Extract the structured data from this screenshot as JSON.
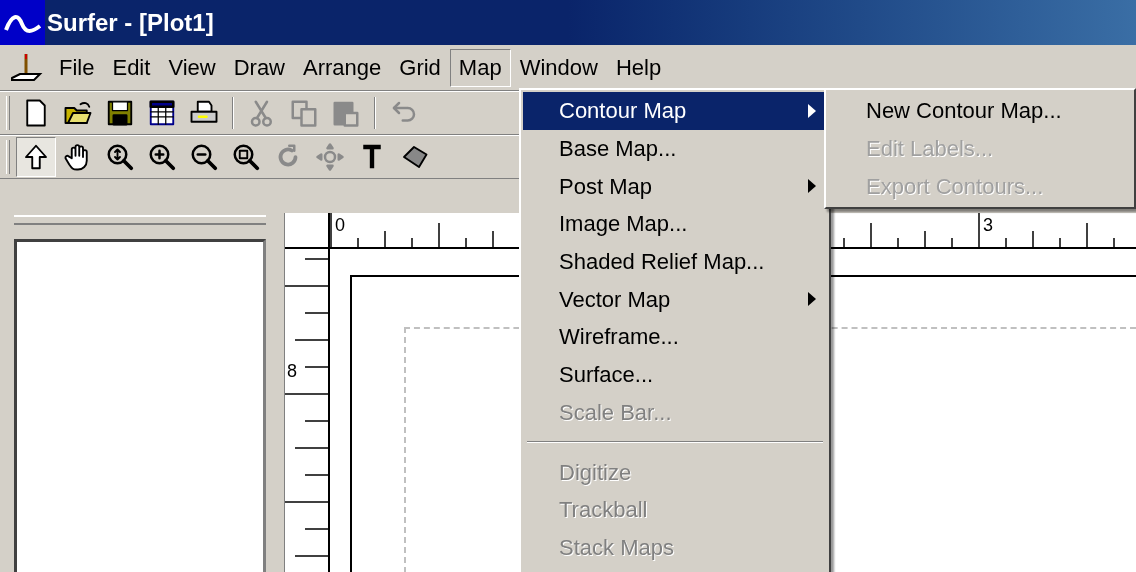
{
  "window": {
    "title": "Surfer - [Plot1]"
  },
  "menubar": [
    {
      "label": "File",
      "selected": false
    },
    {
      "label": "Edit",
      "selected": false
    },
    {
      "label": "View",
      "selected": false
    },
    {
      "label": "Draw",
      "selected": false
    },
    {
      "label": "Arrange",
      "selected": false
    },
    {
      "label": "Grid",
      "selected": false
    },
    {
      "label": "Map",
      "selected": true
    },
    {
      "label": "Window",
      "selected": false
    },
    {
      "label": "Help",
      "selected": false
    }
  ],
  "toolbar_1": [
    {
      "kind": "new",
      "disabled": false
    },
    {
      "kind": "open",
      "disabled": false
    },
    {
      "kind": "save",
      "disabled": false
    },
    {
      "kind": "worksheet",
      "disabled": false
    },
    {
      "kind": "print",
      "disabled": false
    },
    {
      "kind": "separator"
    },
    {
      "kind": "cut",
      "disabled": true
    },
    {
      "kind": "copy",
      "disabled": true
    },
    {
      "kind": "paste",
      "disabled": true
    },
    {
      "kind": "separator"
    },
    {
      "kind": "undo",
      "disabled": true
    }
  ],
  "toolbar_2": [
    {
      "kind": "select",
      "disabled": false,
      "pressed": true
    },
    {
      "kind": "pan",
      "disabled": false,
      "pressed": false
    },
    {
      "kind": "zoom_realtime",
      "disabled": false,
      "pressed": false
    },
    {
      "kind": "zoom_in",
      "disabled": false,
      "pressed": false
    },
    {
      "kind": "zoom_out",
      "disabled": false,
      "pressed": false
    },
    {
      "kind": "zoom_rect",
      "disabled": false,
      "pressed": false
    },
    {
      "kind": "rotate",
      "disabled": true,
      "pressed": false
    },
    {
      "kind": "trackball",
      "disabled": true,
      "pressed": false
    },
    {
      "kind": "text",
      "disabled": false,
      "pressed": false
    },
    {
      "kind": "polygon",
      "disabled": false,
      "pressed": false
    }
  ],
  "rulers": {
    "top_labels": [
      "0",
      "3"
    ],
    "left_labels": [
      "8"
    ]
  },
  "map_menu": [
    {
      "kind": "item",
      "label": "Contour Map",
      "submenu": true,
      "disabled": false,
      "selected": true
    },
    {
      "kind": "item",
      "label": "Base Map...",
      "submenu": false,
      "disabled": false,
      "selected": false
    },
    {
      "kind": "item",
      "label": "Post Map",
      "submenu": true,
      "disabled": false,
      "selected": false
    },
    {
      "kind": "item",
      "label": "Image Map...",
      "submenu": false,
      "disabled": false,
      "selected": false
    },
    {
      "kind": "item",
      "label": "Shaded Relief Map...",
      "submenu": false,
      "disabled": false,
      "selected": false
    },
    {
      "kind": "item",
      "label": "Vector Map",
      "submenu": true,
      "disabled": false,
      "selected": false
    },
    {
      "kind": "item",
      "label": "Wireframe...",
      "submenu": false,
      "disabled": false,
      "selected": false
    },
    {
      "kind": "item",
      "label": "Surface...",
      "submenu": false,
      "disabled": false,
      "selected": false
    },
    {
      "kind": "item",
      "label": "Scale Bar...",
      "submenu": false,
      "disabled": true,
      "selected": false
    },
    {
      "kind": "separator"
    },
    {
      "kind": "item",
      "label": "Digitize",
      "submenu": false,
      "disabled": true,
      "selected": false
    },
    {
      "kind": "item",
      "label": "Trackball",
      "submenu": false,
      "disabled": true,
      "selected": false
    },
    {
      "kind": "item",
      "label": "Stack Maps",
      "submenu": false,
      "disabled": true,
      "selected": false
    }
  ],
  "contour_submenu": [
    {
      "label": "New Contour Map...",
      "disabled": false
    },
    {
      "label": "Edit Labels...",
      "disabled": true
    },
    {
      "label": "Export Contours...",
      "disabled": true
    }
  ]
}
